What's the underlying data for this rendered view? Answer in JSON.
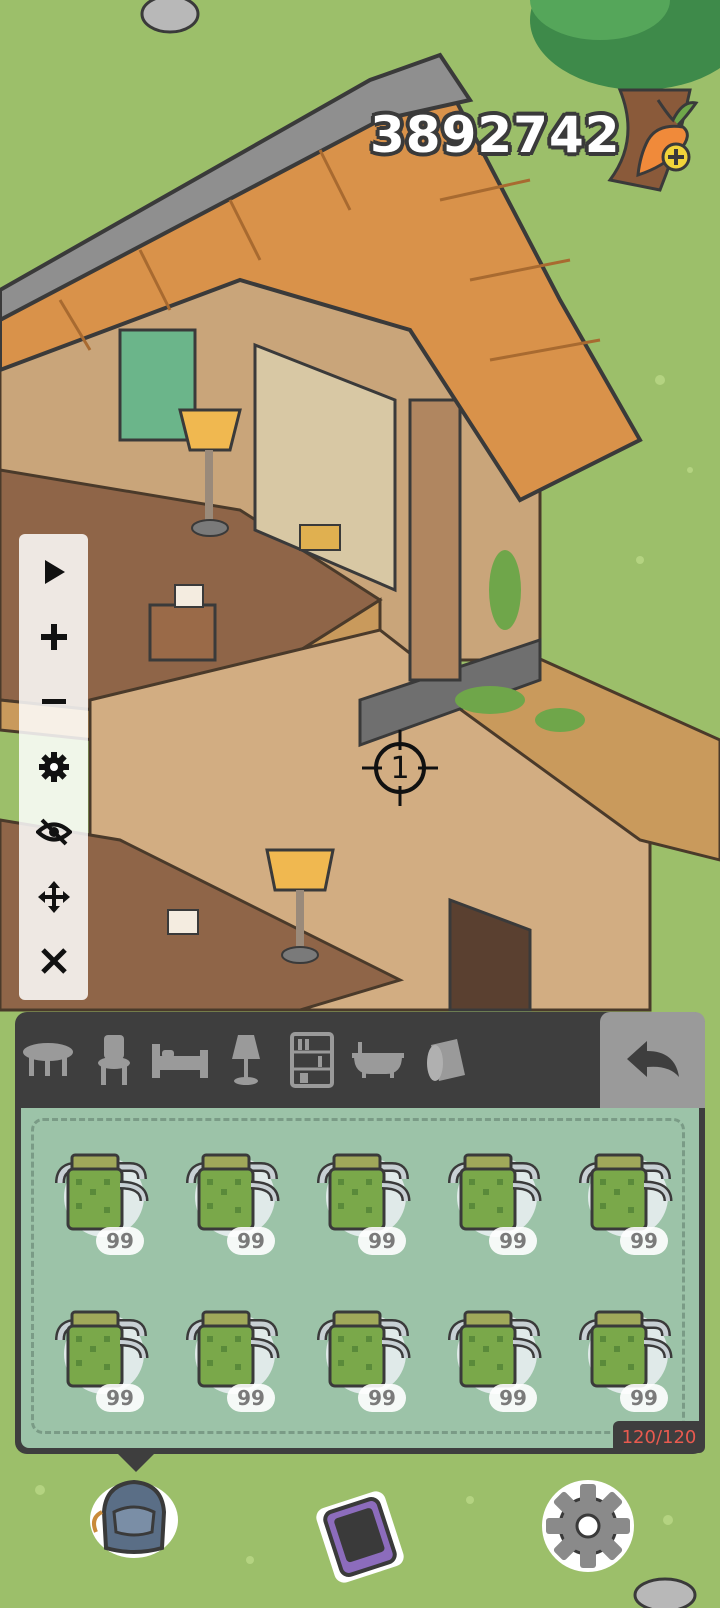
{
  "currency": {
    "value": "3892742",
    "icon": "carrot-add-icon"
  },
  "toolbar": {
    "items": [
      {
        "icon": "play-icon"
      },
      {
        "icon": "plus-icon"
      },
      {
        "icon": "minus-icon"
      },
      {
        "icon": "gear-icon"
      },
      {
        "icon": "eye-slash-icon"
      },
      {
        "icon": "move-arrows-icon"
      },
      {
        "icon": "close-icon"
      }
    ]
  },
  "crosshair": {
    "label": "1"
  },
  "furniture_panel": {
    "tabs": [
      {
        "icon": "table-icon"
      },
      {
        "icon": "chair-icon"
      },
      {
        "icon": "bed-icon"
      },
      {
        "icon": "lamp-icon"
      },
      {
        "icon": "bookshelf-icon"
      },
      {
        "icon": "bathtub-icon"
      },
      {
        "icon": "rug-roll-icon"
      }
    ],
    "back_icon": "back-arrow-icon",
    "items": [
      {
        "icon": "towel-rack-icon",
        "count": "99"
      },
      {
        "icon": "towel-rack-icon",
        "count": "99"
      },
      {
        "icon": "towel-rack-icon",
        "count": "99"
      },
      {
        "icon": "towel-rack-icon",
        "count": "99"
      },
      {
        "icon": "towel-rack-icon",
        "count": "99"
      },
      {
        "icon": "towel-rack-icon",
        "count": "99"
      },
      {
        "icon": "towel-rack-icon",
        "count": "99"
      },
      {
        "icon": "towel-rack-icon",
        "count": "99"
      },
      {
        "icon": "towel-rack-icon",
        "count": "99"
      },
      {
        "icon": "towel-rack-icon",
        "count": "99"
      }
    ],
    "capacity": "120/120"
  },
  "bottom_nav": {
    "items": [
      {
        "icon": "backpack-icon"
      },
      {
        "icon": "phone-icon"
      },
      {
        "icon": "settings-gear-icon"
      }
    ]
  },
  "colors": {
    "grass": "#9cbf6a",
    "panel": "#3e3e3e",
    "inventory": "#9cc3a8",
    "capacity_text": "#e85a4f"
  }
}
